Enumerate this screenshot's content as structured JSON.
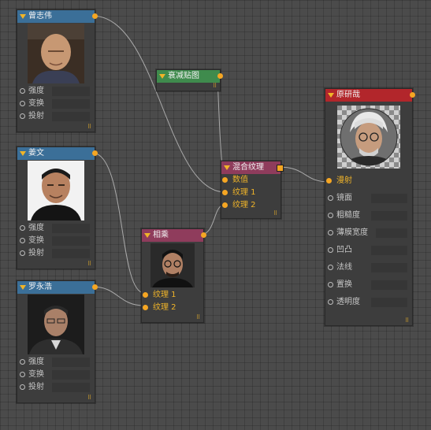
{
  "nodes": {
    "zeng": {
      "title": "曾志伟",
      "inputs": [
        "强度",
        "变换",
        "投射"
      ]
    },
    "jiang": {
      "title": "姜文",
      "inputs": [
        "强度",
        "变换",
        "投射"
      ]
    },
    "luo": {
      "title": "罗永浩",
      "inputs": [
        "强度",
        "变换",
        "投射"
      ]
    },
    "falloff": {
      "title": "衰减贴图"
    },
    "multiply": {
      "title": "相乘",
      "inputs": [
        "纹理 1",
        "纹理 2"
      ]
    },
    "mix": {
      "title": "混合纹理",
      "inputs": [
        "数值",
        "纹理 1",
        "纹理 2"
      ]
    },
    "material": {
      "title": "原研哉",
      "inputs": [
        "漫射",
        "镜面",
        "粗糙度",
        "薄膜宽度",
        "凹凸",
        "法线",
        "置换",
        "透明度"
      ]
    }
  },
  "colors": {
    "wire": "#a9a9a9",
    "port": "#f5a623",
    "header_texture": "#3b6f98",
    "header_falloff": "#3f8b4d",
    "header_operator": "#8f3c5c",
    "header_material": "#b2262b"
  }
}
